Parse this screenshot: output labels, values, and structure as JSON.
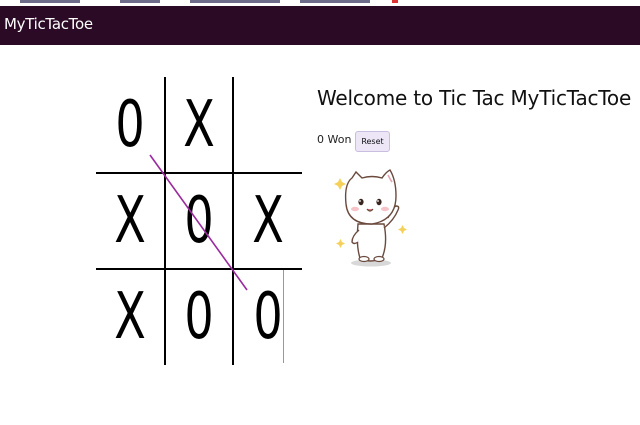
{
  "app": {
    "title": "MyTicTacToe"
  },
  "board": {
    "cells": [
      "0",
      "X",
      "",
      "X",
      "0",
      "X",
      "X",
      "0",
      "0"
    ],
    "winning_line": {
      "from_cell": 0,
      "to_cell": 8,
      "color": "#9a2a9e"
    }
  },
  "info": {
    "welcome": "Welcome to Tic Tac MyTicTacToe",
    "status": "0 Won",
    "reset_label": "Reset"
  },
  "sticker": {
    "icon": "cute-cat-waving-icon"
  },
  "colors": {
    "app_bar": "#2a0a24",
    "app_title": "#ffffff",
    "button_bg": "#ece6f7",
    "grid_lines": "#000000"
  }
}
